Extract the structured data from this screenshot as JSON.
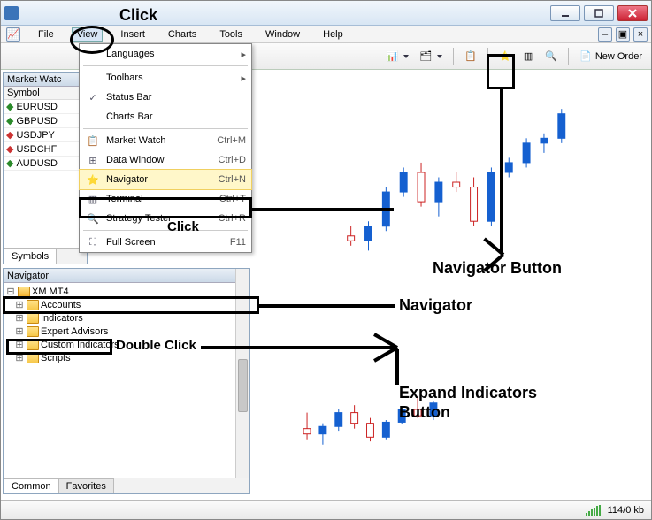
{
  "title": "",
  "menus": [
    "File",
    "View",
    "Insert",
    "Charts",
    "Tools",
    "Window",
    "Help"
  ],
  "view_menu": [
    {
      "label": "Languages",
      "sub": true
    },
    {
      "sep": true
    },
    {
      "label": "Toolbars",
      "sub": true
    },
    {
      "label": "Status Bar",
      "check": true
    },
    {
      "label": "Charts Bar"
    },
    {
      "sep": true
    },
    {
      "label": "Market Watch",
      "shortcut": "Ctrl+M",
      "icon": "mw"
    },
    {
      "label": "Data Window",
      "shortcut": "Ctrl+D",
      "icon": "dw"
    },
    {
      "label": "Navigator",
      "shortcut": "Ctrl+N",
      "icon": "nav",
      "hl": true
    },
    {
      "label": "Terminal",
      "shortcut": "Ctrl+T",
      "icon": "term"
    },
    {
      "label": "Strategy Tester",
      "shortcut": "Ctrl+R",
      "icon": "st"
    },
    {
      "sep": true
    },
    {
      "label": "Full Screen",
      "shortcut": "F11",
      "icon": "fs"
    }
  ],
  "market_watch": {
    "title": "Market Watc",
    "col": "Symbol",
    "rows": [
      {
        "sym": "EURUSD",
        "dir": "up"
      },
      {
        "sym": "GBPUSD",
        "dir": "up"
      },
      {
        "sym": "USDJPY",
        "dir": "dn"
      },
      {
        "sym": "USDCHF",
        "dir": "dn"
      },
      {
        "sym": "AUDUSD",
        "dir": "up"
      }
    ],
    "tab": "Symbols"
  },
  "navigator": {
    "title": "Navigator",
    "root": "XM MT4",
    "items": [
      "Accounts",
      "Indicators",
      "Expert Advisors",
      "Custom Indicators",
      "Scripts"
    ],
    "tabs": [
      "Common",
      "Favorites"
    ]
  },
  "toolbar_order": "New Order",
  "status": {
    "kb": "114/0 kb"
  },
  "annot": {
    "click_view": "Click",
    "click_nav": "Click",
    "double_click": "Double Click",
    "navigator_button": "Navigator Button",
    "navigator": "Navigator",
    "expand": "Expand Indicators Button"
  },
  "chart_data": {
    "type": "candlestick",
    "title": "",
    "note": "approximate candles (open-high-low-close indices, not price-labeled in source)",
    "candles": [
      {
        "o": 50,
        "h": 60,
        "l": 40,
        "c": 45
      },
      {
        "o": 45,
        "h": 65,
        "l": 35,
        "c": 60
      },
      {
        "o": 60,
        "h": 100,
        "l": 55,
        "c": 95
      },
      {
        "o": 95,
        "h": 120,
        "l": 90,
        "c": 115
      },
      {
        "o": 115,
        "h": 125,
        "l": 80,
        "c": 85
      },
      {
        "o": 85,
        "h": 110,
        "l": 70,
        "c": 105
      },
      {
        "o": 105,
        "h": 115,
        "l": 95,
        "c": 100
      },
      {
        "o": 100,
        "h": 110,
        "l": 60,
        "c": 65
      },
      {
        "o": 65,
        "h": 120,
        "l": 60,
        "c": 115
      },
      {
        "o": 115,
        "h": 130,
        "l": 110,
        "c": 125
      },
      {
        "o": 125,
        "h": 150,
        "l": 120,
        "c": 145
      },
      {
        "o": 145,
        "h": 155,
        "l": 135,
        "c": 150
      },
      {
        "o": 150,
        "h": 180,
        "l": 145,
        "c": 175
      }
    ],
    "lower": [
      {
        "o": 40,
        "h": 55,
        "l": 30,
        "c": 35
      },
      {
        "o": 35,
        "h": 45,
        "l": 25,
        "c": 42
      },
      {
        "o": 42,
        "h": 58,
        "l": 38,
        "c": 55
      },
      {
        "o": 55,
        "h": 62,
        "l": 40,
        "c": 45
      },
      {
        "o": 45,
        "h": 50,
        "l": 28,
        "c": 32
      },
      {
        "o": 32,
        "h": 48,
        "l": 30,
        "c": 46
      },
      {
        "o": 46,
        "h": 60,
        "l": 44,
        "c": 58
      },
      {
        "o": 58,
        "h": 70,
        "l": 50,
        "c": 52
      },
      {
        "o": 52,
        "h": 66,
        "l": 48,
        "c": 64
      }
    ]
  }
}
